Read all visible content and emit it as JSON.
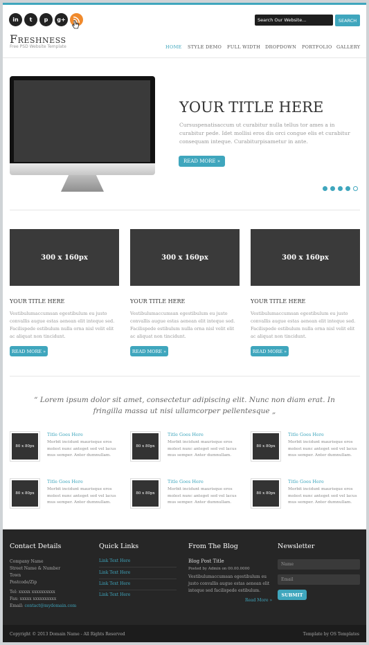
{
  "header": {
    "social": [
      "in",
      "t",
      "p",
      "g+",
      "rss"
    ],
    "search_placeholder": "Search Our Website...",
    "search_button": "SEARCH",
    "logo": "Freshness",
    "tagline": "Free PSD Website Template",
    "nav": [
      "HOME",
      "STYLE DEMO",
      "FULL WIDTH",
      "DROPDOWN",
      "PORTFOLIO",
      "GALLERY"
    ]
  },
  "hero": {
    "title": "YOUR TITLE HERE",
    "text": "Cursuspenatisaccum ut curabitur nulla tellus tor ames a in curabitur pede. Idet mollisi eros dis orci congue elis et curabitur consequam inteque. Curabiturpisametur in ante.",
    "button": "READ MORE »",
    "slides": 5,
    "active_slide": 5
  },
  "columns": [
    {
      "thumb": "300 x 160px",
      "title": "YOUR TITLE HERE",
      "text": "Vestibulumaccumsan egestibulum eu justo convallis augue estas aenean elit inteque sed. Facilispede estibulum nulla orna nisl velit elit ac aliquat non tincidunt.",
      "button": "READ MORE »"
    },
    {
      "thumb": "300 x 160px",
      "title": "YOUR TITLE HERE",
      "text": "Vestibulumaccumsan egestibulum eu justo convallis augue estas aenean elit inteque sed. Facilispede estibulum nulla orna nisl velit elit ac aliquat non tincidunt.",
      "button": "READ MORE »"
    },
    {
      "thumb": "300 x 160px",
      "title": "YOUR TITLE HERE",
      "text": "Vestibulumaccumsan egestibulum eu justo convallis augue estas aenean elit inteque sed. Facilispede estibulum nulla orna nisl velit elit ac aliquat non tincidunt.",
      "button": "READ MORE »"
    }
  ],
  "quote": "“ Lorem ipsum dolor sit amet, consectetur adipiscing elit. Nunc non diam erat. In fringilla massa ut nisi ullamcorper pellentesque „",
  "mini_posts": [
    {
      "thumb": "80 x 80px",
      "title": "Title Goes Here",
      "text": "Morbit incidunt maurisque eros molest nunc anteget sed vel lacus mus semper. Anter dumnullam."
    },
    {
      "thumb": "80 x 80px",
      "title": "Title Goes Here",
      "text": "Morbit incidunt maurisque eros molest nunc anteget sed vel lacus mus semper. Anter dumnullam."
    },
    {
      "thumb": "80 x 80px",
      "title": "Title Goes Here",
      "text": "Morbit incidunt maurisque eros molest nunc anteget sed vel lacus mus semper. Anter dumnullam."
    },
    {
      "thumb": "80 x 80px",
      "title": "Title Goes Here",
      "text": "Morbit incidunt maurisque eros molest nunc anteget sed vel lacus mus semper. Anter dumnullam."
    },
    {
      "thumb": "80 x 80px",
      "title": "Title Goes Here",
      "text": "Morbit incidunt maurisque eros molest nunc anteget sed vel lacus mus semper. Anter dumnullam."
    },
    {
      "thumb": "80 x 80px",
      "title": "Title Goes Here",
      "text": "Morbit incidunt maurisque eros molest nunc anteget sed vel lacus mus semper. Anter dumnullam."
    }
  ],
  "footer": {
    "contact": {
      "heading": "Contact Details",
      "lines": [
        "Company Name",
        "Street Name & Number",
        "Town",
        "Postcode/Zip"
      ],
      "tel": "Tel: xxxxx xxxxxxxxxx",
      "fax": "Fax: xxxxx xxxxxxxxxx",
      "email_label": "Email:",
      "email": "contact@mydomain.com"
    },
    "links": {
      "heading": "Quick Links",
      "items": [
        "Link Text Here",
        "Link Text Here",
        "Link Text Here",
        "Link Text Here"
      ]
    },
    "blog": {
      "heading": "From The Blog",
      "title": "Blog Post Title",
      "meta": "Posted by Admin on 00.00.0000",
      "text": "Vestibulumaccumsan egestibulum eu justo convallis augue estas aenean elit inteque sed facilispede estibulum.",
      "more": "Read More »"
    },
    "newsletter": {
      "heading": "Newsletter",
      "name_placeholder": "Name",
      "email_placeholder": "Email",
      "button": "SUBMIT"
    },
    "copyright": "Copyright © 2013 Domain Name - All Rights Reserved",
    "credit": "Template by OS Templates"
  },
  "colors": {
    "accent": "#3fa6bd",
    "footer": "#262626",
    "rss": "#f08a2c"
  }
}
